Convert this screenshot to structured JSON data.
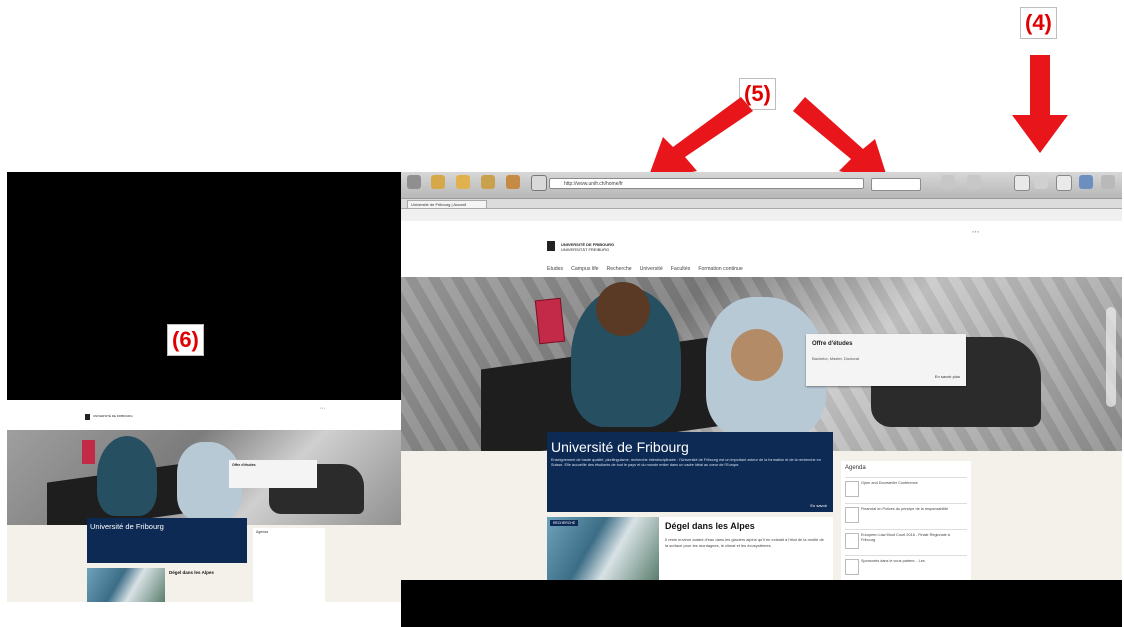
{
  "callouts": {
    "four": "(4)",
    "five": "(5)",
    "six": "(6)"
  },
  "colors": {
    "callout_text": "#e00000",
    "arrow": "#e8151b",
    "uni_blue": "#0d2a55"
  },
  "browser": {
    "url": "http://www.unifr.ch/home/fr",
    "tab_label": "Université de Fribourg | Accueil",
    "toolbar_icons": [
      "back-icon",
      "forward-icon",
      "reload-icon",
      "home-icon",
      "bookmarks-icon",
      "edit-icon",
      "user-icon",
      "screen-icon",
      "display-icon",
      "settings-icon"
    ]
  },
  "site": {
    "logo_line1": "UNIVERSITÉ DE FRIBOURG",
    "logo_line2": "UNIVERSITÄT FREIBURG",
    "nav": [
      "Etudes",
      "Campus life",
      "Recherche",
      "Université",
      "Facultés",
      "Formation continue"
    ],
    "hero_offer": {
      "title": "Offre d'études",
      "subtitle": "Bachelor, Master, Doctorat",
      "more": "En savoir plus"
    },
    "uni": {
      "title": "Université de Fribourg",
      "text": "Enseignement de haute qualité, plurilinguisme, recherche interdisciplinaire : l'Université de Fribourg est un important acteur de la formation et de la recherche en Suisse. Elle accueille des étudiants de tout le pays et du monde entier dans un cadre idéal au cœur de l'Europe.",
      "more": "En savoir"
    },
    "news": {
      "tag": "RECHERCHE",
      "title": "Dégel dans les Alpes",
      "text": "Il reste environ autant d'eau dans les glaciers alpins qu'il en existait à l'état de la moitié de la surface pour les montagnes, le climat et les écosystèmes."
    },
    "agenda": {
      "title": "Agenda",
      "items": [
        "Open and Doorsteller Conférence",
        "Financial en Polices du principe de la responsabilité",
        "Europeen Law Moot Court 2016 - Finale Régionale à Fribourg",
        "Sponsorés dans le vous partenr... Les"
      ]
    }
  },
  "left_site": {
    "uni_title": "Université de Fribourg",
    "offer_title": "Offre d'études",
    "news_title": "Dégel dans les Alpes",
    "agenda_title": "Agenda"
  }
}
